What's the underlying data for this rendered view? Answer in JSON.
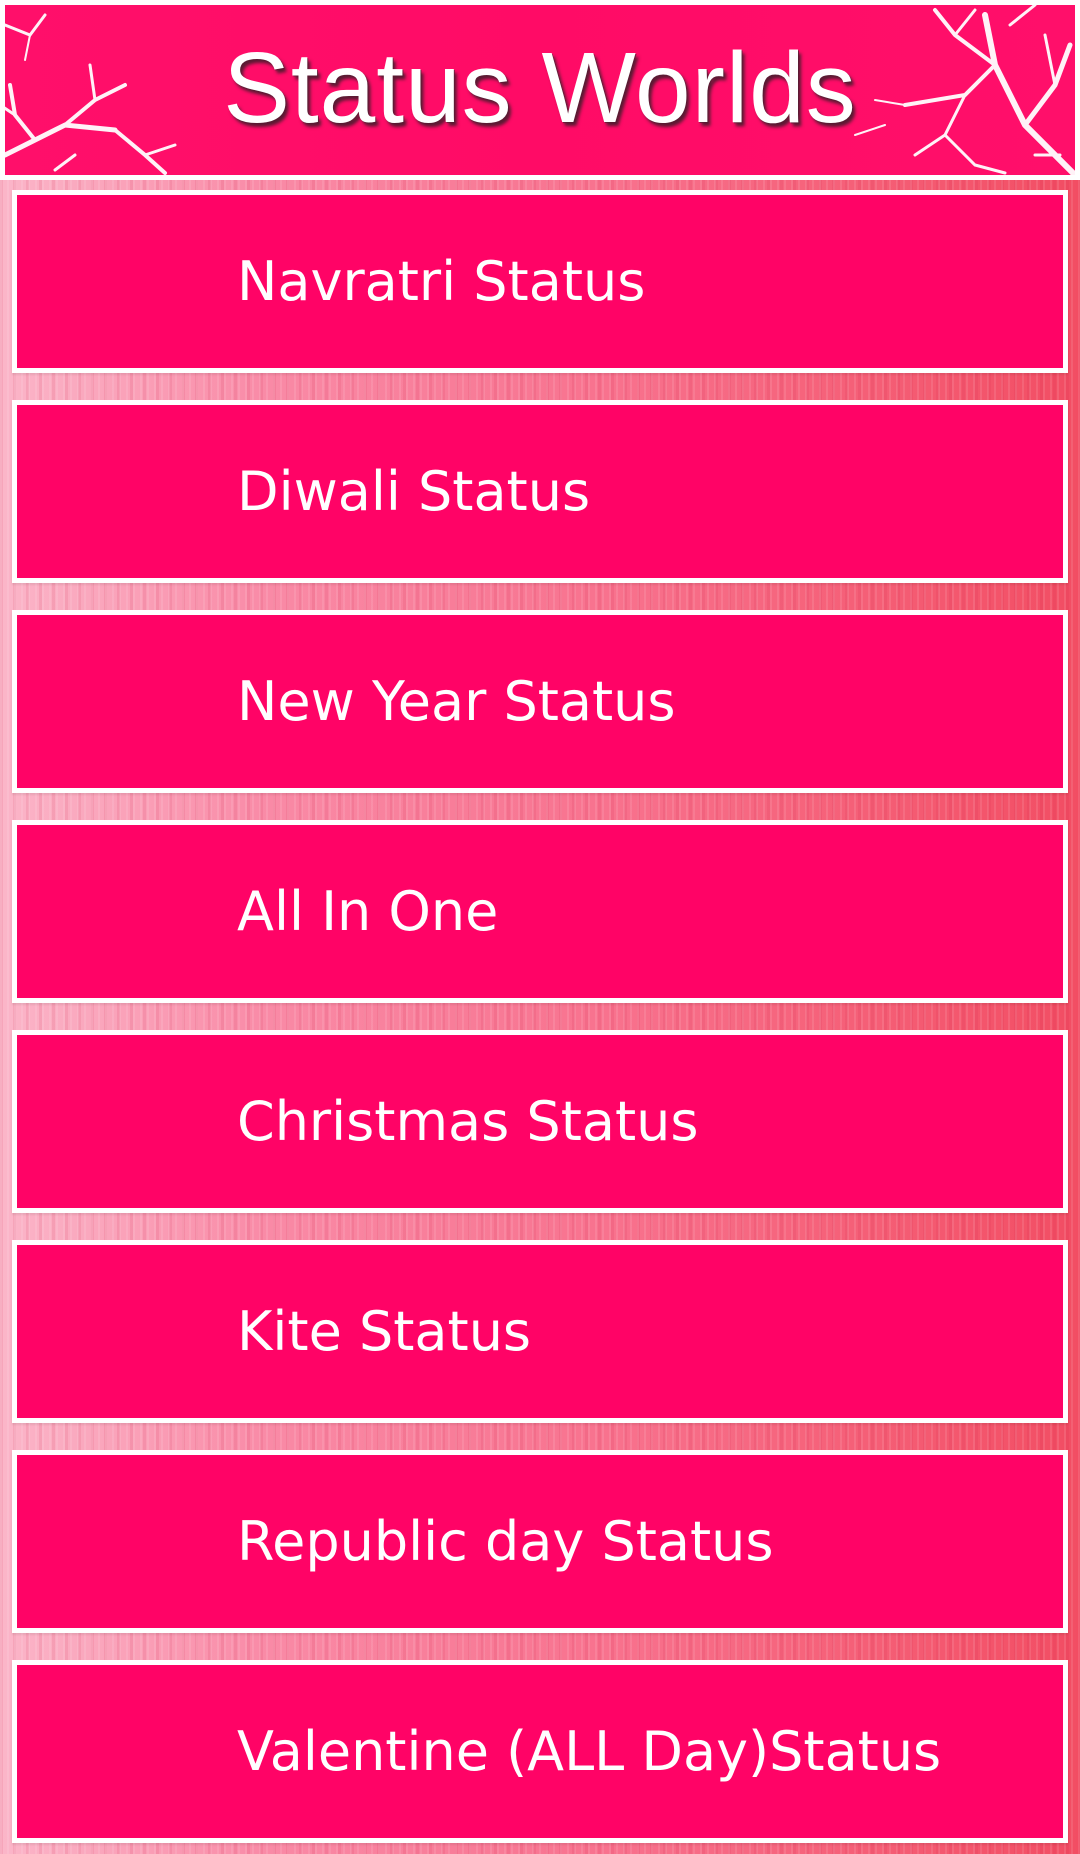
{
  "header": {
    "title": "Status Worlds"
  },
  "colors": {
    "accent": "#ff0366",
    "header_background": "#ff0b66",
    "border": "#ffffff",
    "text": "#ffffff"
  },
  "menu": {
    "items": [
      {
        "label": "Navratri Status"
      },
      {
        "label": "Diwali Status"
      },
      {
        "label": "New Year Status"
      },
      {
        "label": "All In One"
      },
      {
        "label": "Christmas Status"
      },
      {
        "label": "Kite Status"
      },
      {
        "label": "Republic day Status"
      },
      {
        "label": "Valentine (ALL Day)Status"
      }
    ]
  }
}
